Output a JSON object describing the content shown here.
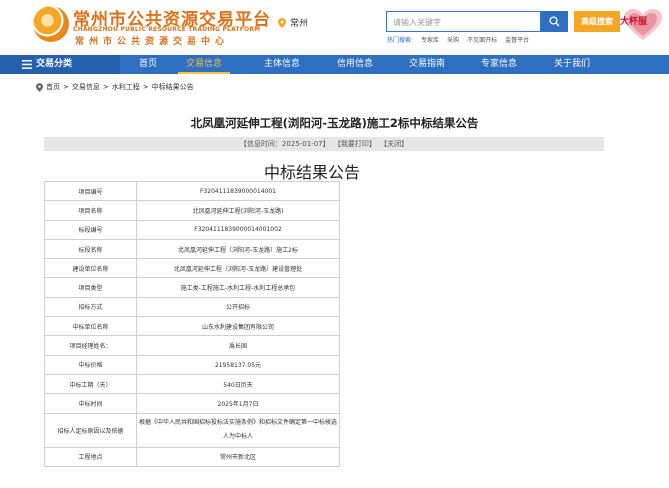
{
  "header": {
    "logo_cn": "常州市公共资源交易平台",
    "logo_en": "CHANGZHOU PUBLIC RESOURCE TRADING PLATFORM",
    "logo_cn_sub": "常州市公共资源交易中心",
    "city": "常州",
    "search_placeholder": "请输入关键字",
    "advanced_search_label": "高级搜索",
    "hot_label": "热门搜索:",
    "hot_items": [
      "专家库",
      "采购",
      "不见面开标",
      "监督平台"
    ],
    "badge_text": "大杯服"
  },
  "nav": {
    "category_label": "交易分类",
    "items": [
      {
        "label": "首页"
      },
      {
        "label": "交易信息"
      },
      {
        "label": "主体信息"
      },
      {
        "label": "信用信息"
      },
      {
        "label": "交易指南"
      },
      {
        "label": "专家信息"
      },
      {
        "label": "关于我们"
      }
    ],
    "active_index": 1
  },
  "breadcrumb": {
    "items": [
      "首页",
      "交易信息",
      "水利工程",
      "中标结果公告"
    ],
    "separator": ">"
  },
  "article": {
    "title": "北凤凰河延伸工程(浏阳河-玉龙路)施工2标中标结果公告",
    "info_time": "【信息时间：2025-01-07】",
    "print_label": "【我要打印】",
    "close_label": "【关闭】",
    "heading": "中标结果公告"
  },
  "result_table": [
    {
      "key": "项目编号",
      "value": "F3204111839000014001"
    },
    {
      "key": "项目名称",
      "value": "北凤凰河延伸工程(浏阳河-玉龙路)"
    },
    {
      "key": "标段编号",
      "value": "F3204111839000014001002"
    },
    {
      "key": "标段名称",
      "value": "北凤凰河延伸工程（浏阳河-玉龙路）施工2标"
    },
    {
      "key": "建设单位名称",
      "value": "北凤凰河延伸工程（浏阳河-玉龙路）建设管理处"
    },
    {
      "key": "项目类型",
      "value": "施工类-工程施工-水利工程-水利工程总承包"
    },
    {
      "key": "招标方式",
      "value": "公开招标"
    },
    {
      "key": "中标单位名称",
      "value": "山东水利建设集团有限公司"
    },
    {
      "key": "项目经理姓名：",
      "value": "禹长国"
    },
    {
      "key": "中标价格",
      "value": "21958137.05元"
    },
    {
      "key": "中标工期（天）",
      "value": "540日历天"
    },
    {
      "key": "中标时间",
      "value": "2025年1月7日"
    },
    {
      "key": "招标人定标原因以及依据",
      "value": "根据《中华人民共和国招标投标法实施条例》和招标文件确定第一中标候选人为中标人"
    },
    {
      "key": "工程地点",
      "value": "常州市新北区"
    }
  ],
  "colors": {
    "brand_orange": "#d9731c",
    "nav_blue": "#2d6fc0",
    "nav_active": "#f7c23f",
    "search_button": "#2e6fc2",
    "advanced_button": "#f5a623"
  },
  "icons": {
    "city": "location-pin-icon",
    "search": "search-icon",
    "category": "menu-icon",
    "breadcrumb": "location-pin-icon"
  }
}
